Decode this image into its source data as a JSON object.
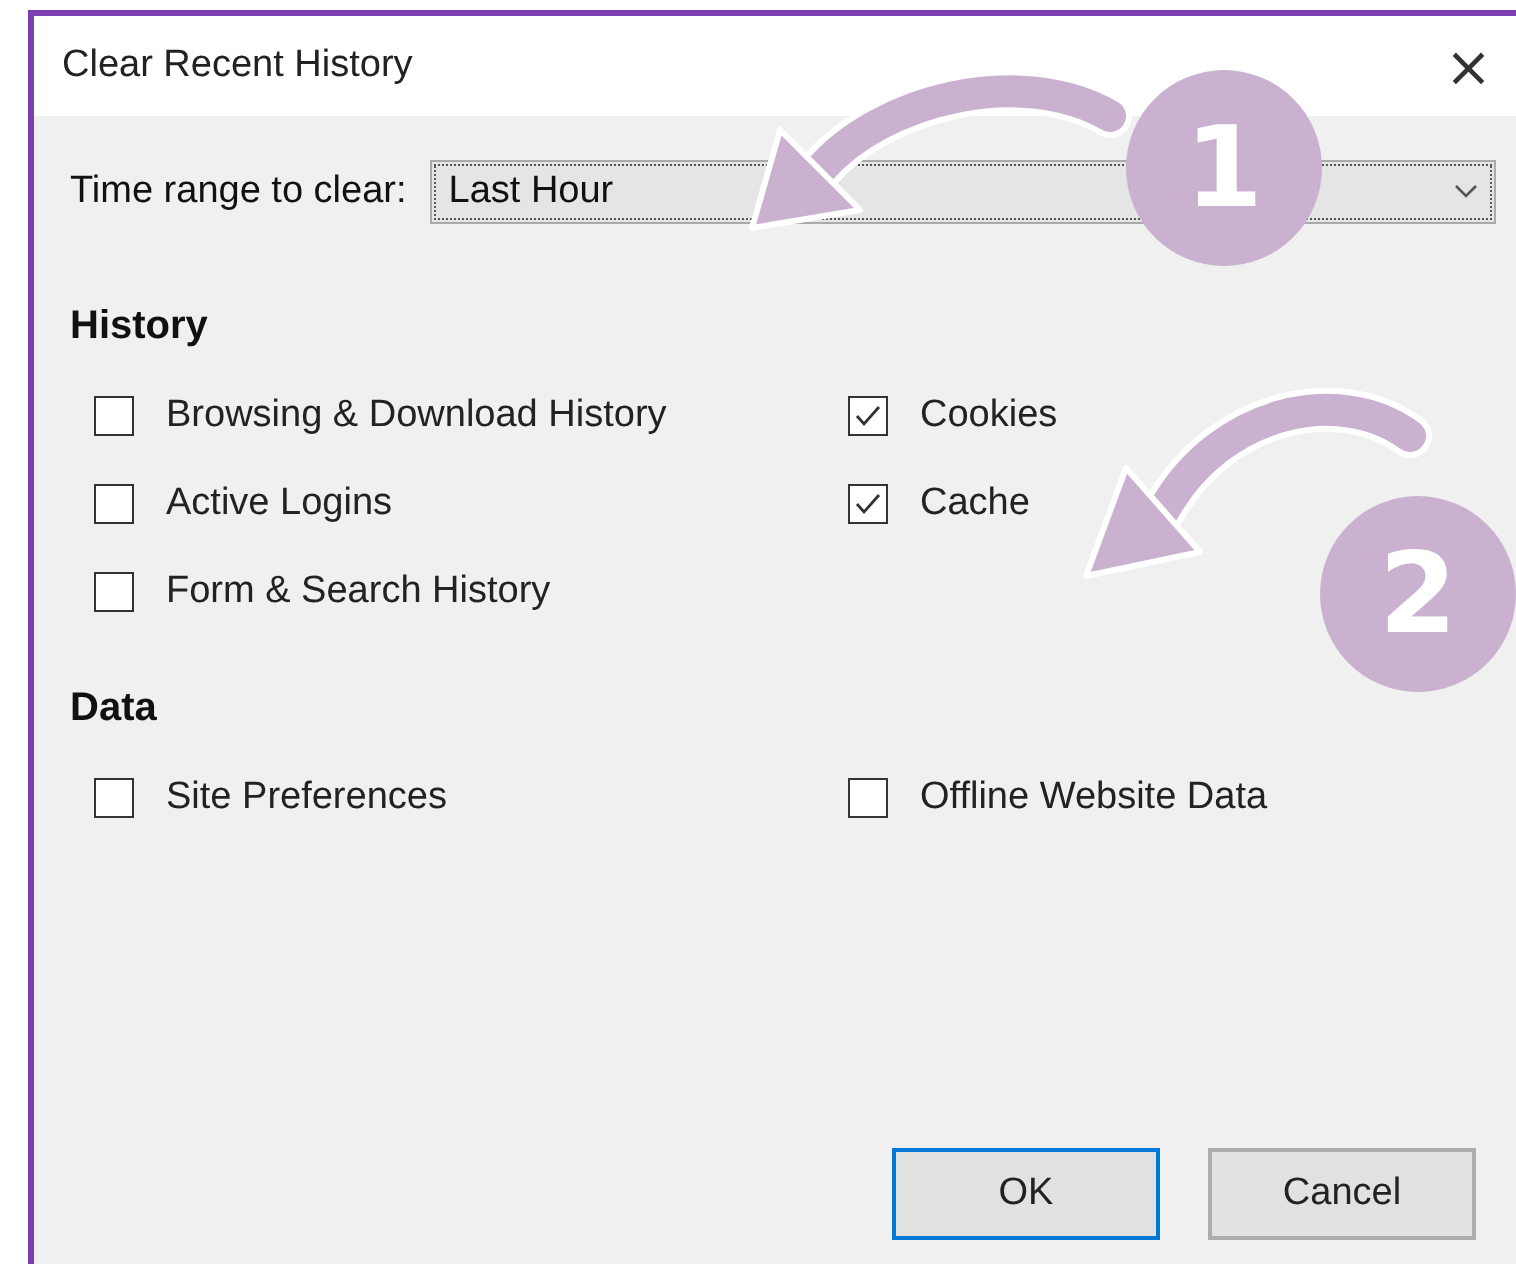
{
  "window": {
    "title": "Clear Recent History",
    "close": "×"
  },
  "time_range": {
    "label": "Time range to clear:",
    "value": "Last Hour"
  },
  "sections": [
    {
      "heading": "History",
      "items": [
        {
          "label": "Browsing & Download History",
          "checked": false
        },
        {
          "label": "Cookies",
          "checked": true
        },
        {
          "label": "Active Logins",
          "checked": false
        },
        {
          "label": "Cache",
          "checked": true
        },
        {
          "label": "Form & Search History",
          "checked": false
        }
      ]
    },
    {
      "heading": "Data",
      "items": [
        {
          "label": "Site Preferences",
          "checked": false
        },
        {
          "label": "Offline Website Data",
          "checked": false
        }
      ]
    }
  ],
  "buttons": [
    {
      "label": "OK",
      "default": true
    },
    {
      "label": "Cancel",
      "default": false
    }
  ],
  "annotations": [
    {
      "label": "1"
    },
    {
      "label": "2"
    }
  ]
}
